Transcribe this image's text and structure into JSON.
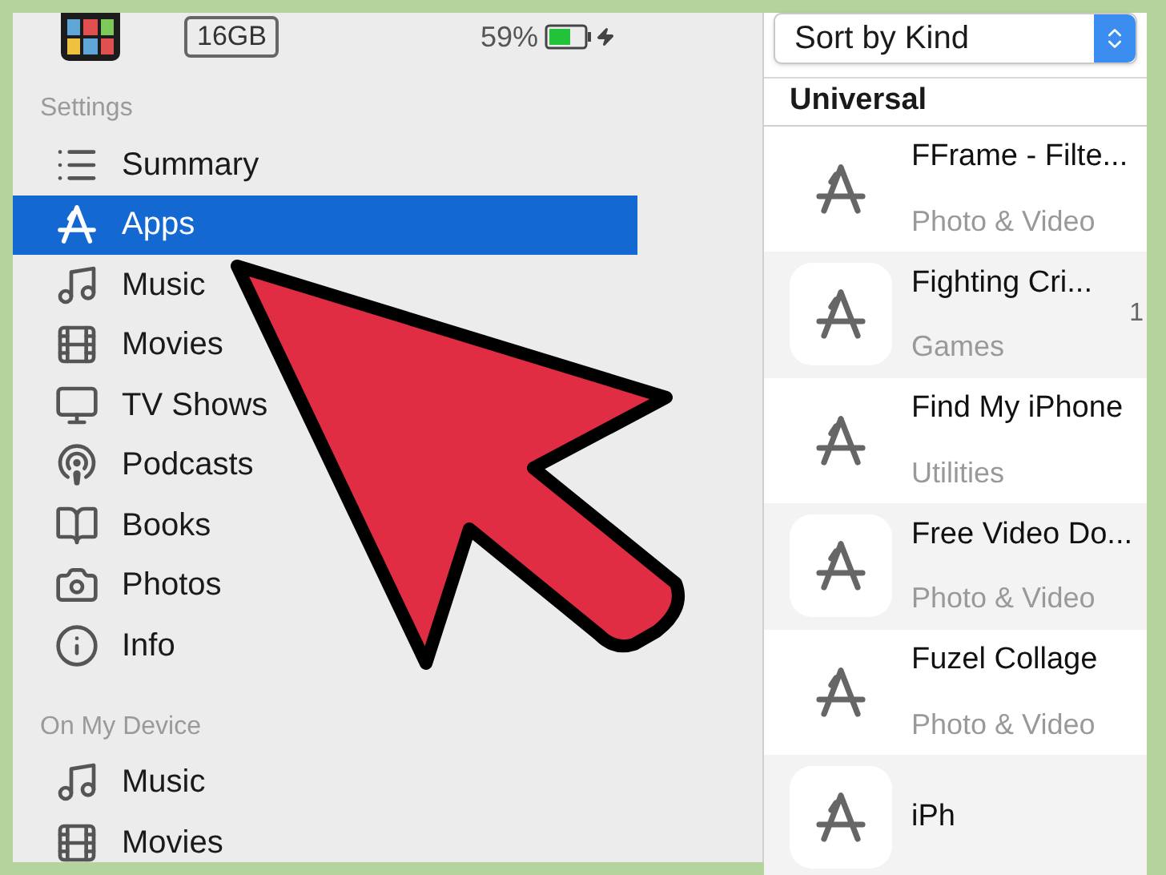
{
  "device": {
    "capacity": "16GB",
    "battery": "59%"
  },
  "sidebar": {
    "sections": [
      {
        "title": "Settings",
        "items": [
          {
            "label": "Summary",
            "kind": "summary",
            "selected": false
          },
          {
            "label": "Apps",
            "kind": "apps",
            "selected": true
          },
          {
            "label": "Music",
            "kind": "music",
            "selected": false
          },
          {
            "label": "Movies",
            "kind": "movies",
            "selected": false
          },
          {
            "label": "TV Shows",
            "kind": "tv",
            "selected": false
          },
          {
            "label": "Podcasts",
            "kind": "podcasts",
            "selected": false
          },
          {
            "label": "Books",
            "kind": "books",
            "selected": false
          },
          {
            "label": "Photos",
            "kind": "photos",
            "selected": false
          },
          {
            "label": "Info",
            "kind": "info",
            "selected": false
          }
        ]
      },
      {
        "title": "On My Device",
        "items": [
          {
            "label": "Music",
            "kind": "music",
            "selected": false
          },
          {
            "label": "Movies",
            "kind": "movies",
            "selected": false
          }
        ]
      }
    ]
  },
  "apps_panel": {
    "sort": "Sort by Kind",
    "group": "Universal",
    "apps": [
      {
        "name": "FFrame - Filte...",
        "category": "Photo & Video"
      },
      {
        "name": "Fighting Cri...",
        "category": "Games",
        "column_3": "1"
      },
      {
        "name": "Find My iPhone",
        "category": "Utilities"
      },
      {
        "name": "Free Video Do...",
        "category": "Photo & Video"
      },
      {
        "name": "Fuzel Collage",
        "category": "Photo & Video"
      },
      {
        "name": "iPh"
      }
    ]
  }
}
